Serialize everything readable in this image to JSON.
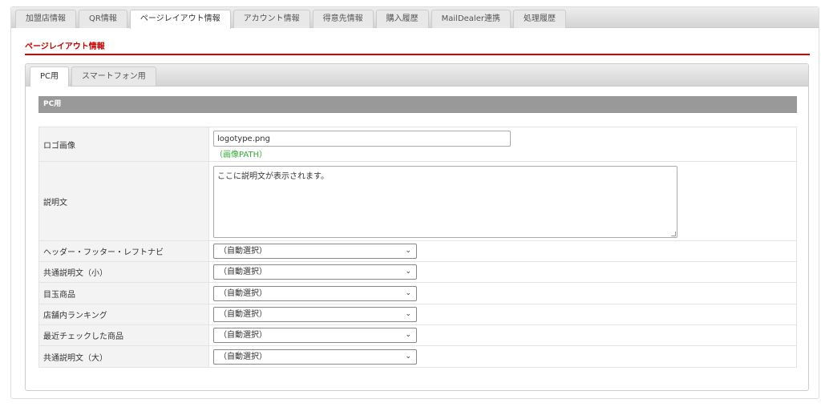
{
  "top_tabs": [
    "加盟店情報",
    "QR情報",
    "ページレイアウト情報",
    "アカウント情報",
    "得意先情報",
    "購入履歴",
    "MailDealer連携",
    "処理履歴"
  ],
  "heading": "ページレイアウト情報",
  "sub_tabs": [
    "PC用",
    "スマートフォン用"
  ],
  "section_title": "PC用",
  "logo": {
    "label": "ロゴ画像",
    "value": "logotype.png",
    "hint": "（画像PATH）"
  },
  "description": {
    "label": "説明文",
    "value": "ここに説明文が表示されます。"
  },
  "selects": [
    {
      "label": "ヘッダー・フッター・レフトナビ",
      "value": "（自動選択）"
    },
    {
      "label": "共通説明文（小）",
      "value": "（自動選択）"
    },
    {
      "label": "目玉商品",
      "value": "（自動選択）"
    },
    {
      "label": "店舗内ランキング",
      "value": "（自動選択）"
    },
    {
      "label": "最近チェックした商品",
      "value": "（自動選択）"
    },
    {
      "label": "共通説明文（大）",
      "value": "（自動選択）"
    }
  ]
}
